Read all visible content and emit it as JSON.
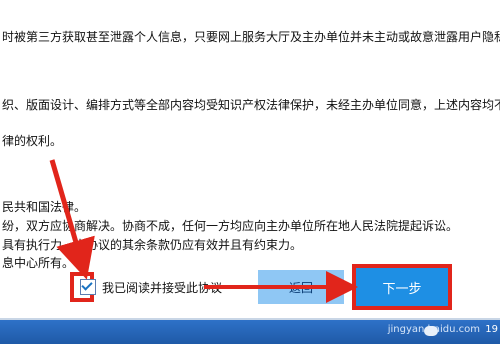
{
  "document": {
    "lines": [
      "时被第三方获取甚至泄露个人信息，只要网上服务大厅及主办单位并未主动或故意泄露用户隐私，",
      "织、版面设计、编排方式等全部内容均受知识产权法律保护，未经主办单位同意，上述内容均不得",
      "律的权利。",
      "民共和国法律。",
      "纷，双方应协商解决。协商不成，任何一方均应向主办单位所在地人民法院提起诉讼。",
      "具有执行力，本协议的其余条款仍应有效并且有约束力。",
      "息中心所有。"
    ]
  },
  "controls": {
    "agree_label": "我已阅读并接受此协议",
    "back_label": "返回",
    "next_label": "下一步"
  },
  "taskbar": {
    "watermark": "jingyan.baidu.com",
    "clock": "19"
  },
  "colors": {
    "highlight": "#e1251b",
    "next_button": "#1e8fe4",
    "back_button": "#8fc7f4"
  }
}
